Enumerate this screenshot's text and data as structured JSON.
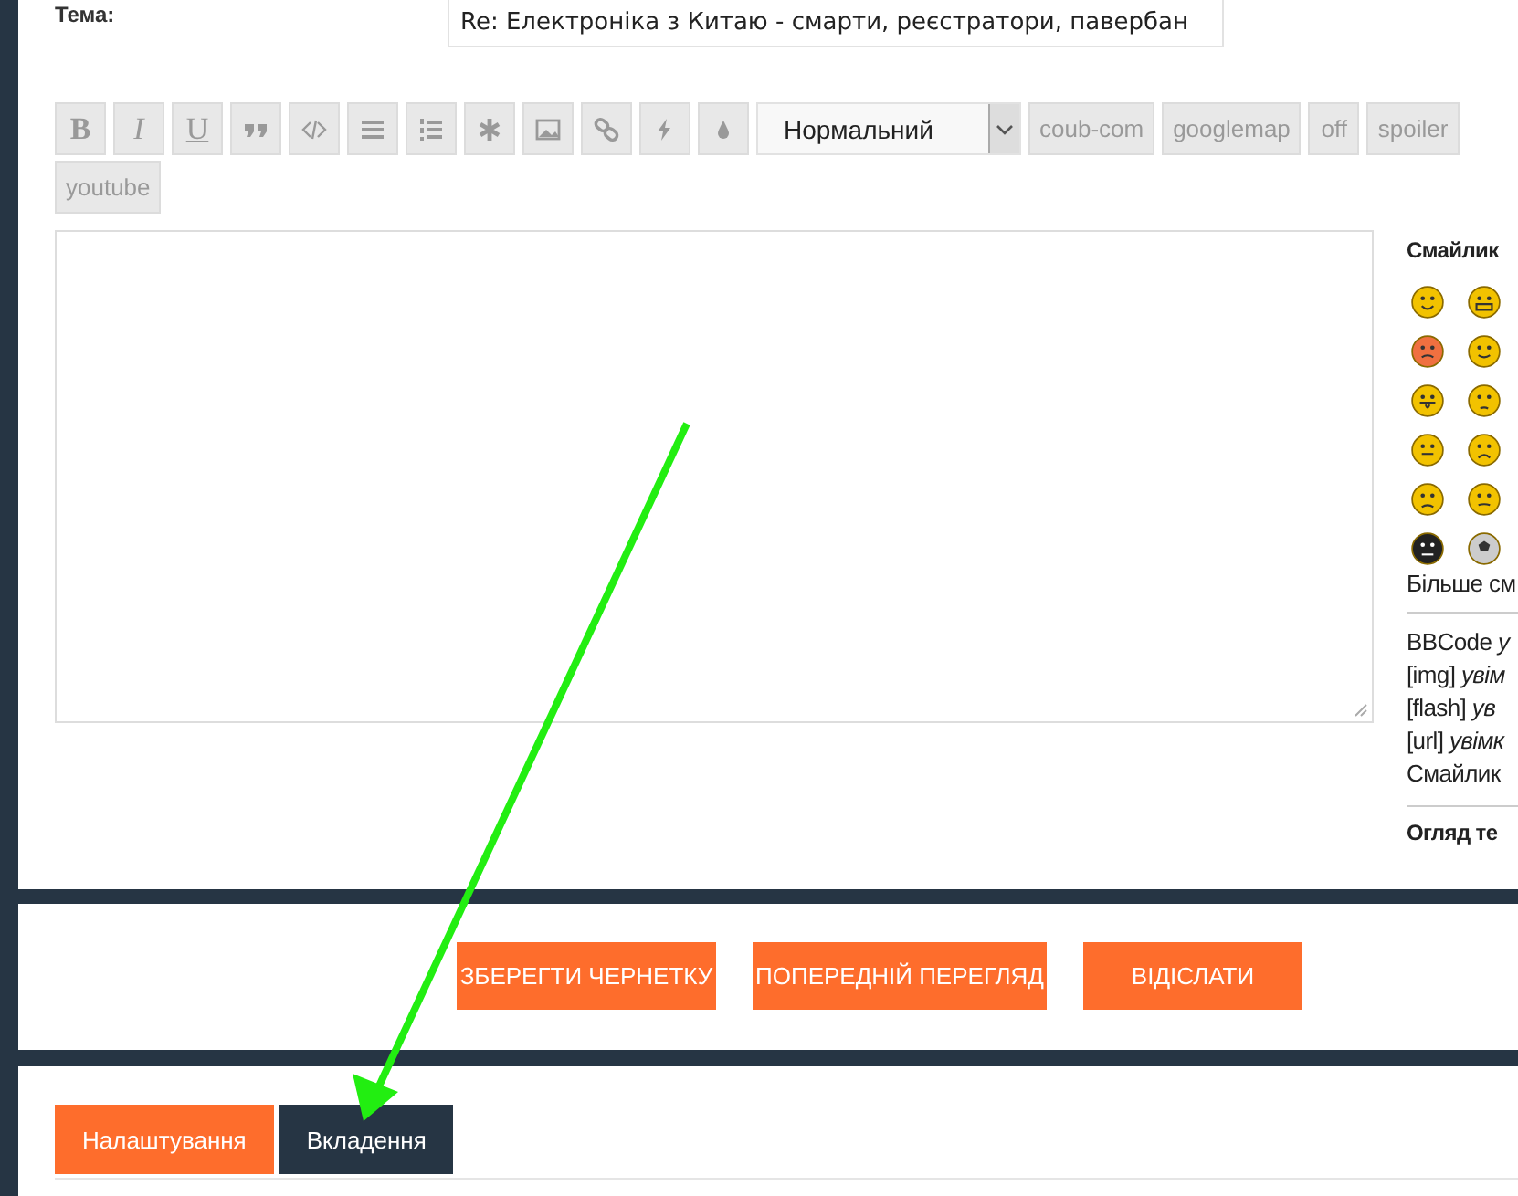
{
  "subject": {
    "label": "Тема:",
    "value": "Re: Електроніка з Китаю - смарти, реєстратори, павербан"
  },
  "toolbar": {
    "format_buttons": [
      "B",
      "I",
      "U"
    ],
    "size_select": "Нормальний",
    "tag_buttons": [
      "coub-com",
      "googlemap",
      "off",
      "spoiler",
      "youtube"
    ]
  },
  "side_panel": {
    "smilies_title": "Смайлик",
    "more_smilies": "Більше см",
    "settings": [
      "BBCode *у*",
      "[img] *увім*",
      "[flash] *ув*",
      "[url] *увімк*",
      "Смайлик"
    ],
    "review_title": "Огляд те"
  },
  "actions": [
    "ЗБЕРЕГТИ ЧЕРНЕТКУ",
    "ПОПЕРЕДНІЙ ПЕРЕГЛЯД",
    "ВІДІСЛАТИ"
  ],
  "tabs": [
    {
      "label": "Налаштування",
      "selected": false
    },
    {
      "label": "Вкладення",
      "selected": true
    }
  ]
}
